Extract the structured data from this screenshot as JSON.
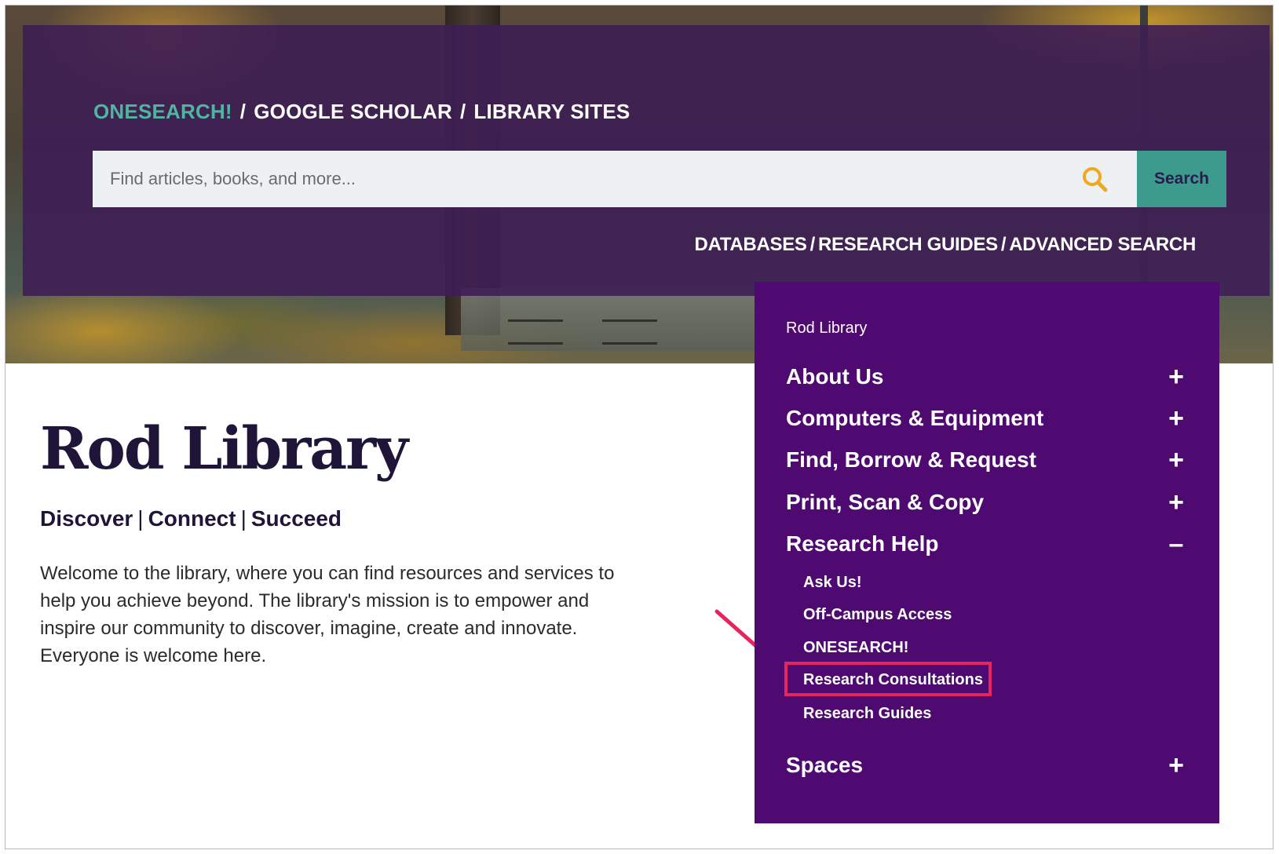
{
  "header": {
    "breadcrumbs": [
      {
        "label": "ONESEARCH!",
        "active": true
      },
      {
        "label": "GOOGLE SCHOLAR",
        "active": false
      },
      {
        "label": "LIBRARY SITES",
        "active": false
      }
    ],
    "separator": "/",
    "search": {
      "placeholder": "Find articles, books, and more...",
      "value": "",
      "button_label": "Search",
      "icon": "search-icon"
    },
    "quick_links": [
      "DATABASES",
      "RESEARCH GUIDES",
      "ADVANCED SEARCH"
    ]
  },
  "main": {
    "title": "Rod Library",
    "tagline": [
      "Discover",
      "Connect",
      "Succeed"
    ],
    "tagline_separator": "|",
    "welcome": "Welcome to the library, where you can find resources and services to help you achieve beyond. The library's mission is to empower and inspire our community to discover, imagine, create and innovate. Everyone is welcome here."
  },
  "menu": {
    "heading": "Rod Library",
    "items": [
      {
        "label": "About Us",
        "toggle": "+"
      },
      {
        "label": "Computers & Equipment",
        "toggle": "+"
      },
      {
        "label": "Find, Borrow & Request",
        "toggle": "+"
      },
      {
        "label": "Print, Scan & Copy",
        "toggle": "+"
      },
      {
        "label": "Research Help",
        "toggle": "–",
        "expanded": true,
        "children": [
          "Ask Us!",
          "Off-Campus Access",
          "ONESEARCH!",
          "Research Consultations",
          "Research Guides"
        ]
      },
      {
        "label": "Spaces",
        "toggle": "+"
      }
    ],
    "highlighted_child": "Research Consultations"
  },
  "colors": {
    "overlay": "#3e1e54",
    "menu_bg": "#4e0a70",
    "accent_teal": "#4fb5a1",
    "search_button": "#3c9b8c",
    "search_icon": "#f0a81c",
    "highlight": "#e6245e",
    "title": "#1f1538"
  }
}
